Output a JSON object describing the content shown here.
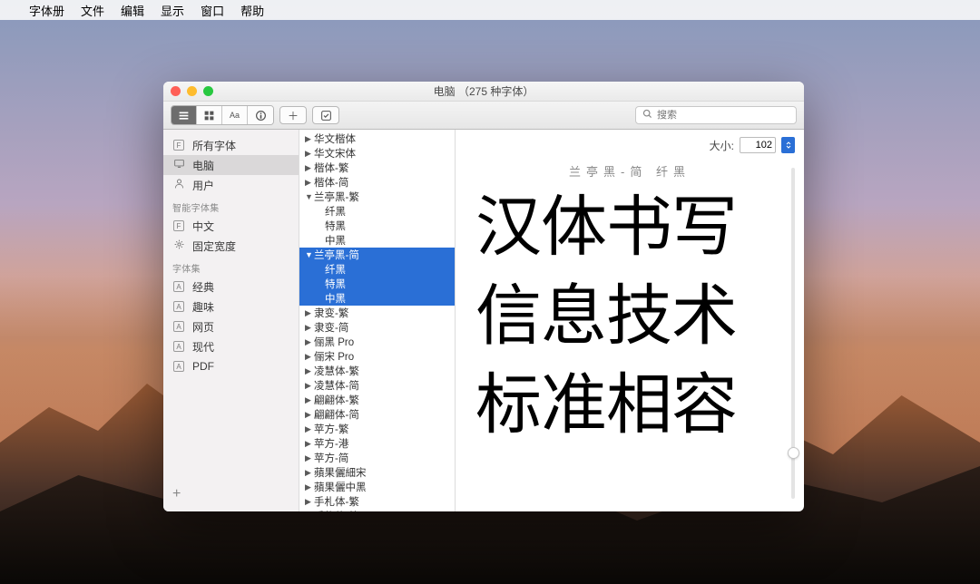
{
  "menubar": {
    "apple": "",
    "items": [
      "字体册",
      "文件",
      "编辑",
      "显示",
      "窗口",
      "帮助"
    ]
  },
  "window": {
    "title": "电脑  （275 种字体）"
  },
  "toolbar": {
    "view_list": "≡",
    "view_grid": "⊞",
    "view_sample": "Aa",
    "view_info": "ⓘ",
    "add": "＋",
    "toggle": "☑",
    "search_placeholder": "搜索"
  },
  "sidebar": {
    "collections": [
      {
        "icon": "F",
        "label": "所有字体",
        "key": "all-fonts"
      },
      {
        "icon": "monitor",
        "label": "电脑",
        "key": "computer",
        "selected": true
      },
      {
        "icon": "user",
        "label": "用户",
        "key": "user"
      }
    ],
    "smart_header": "智能字体集",
    "smart": [
      {
        "icon": "F",
        "label": "中文",
        "key": "chinese"
      },
      {
        "icon": "gear",
        "label": "固定宽度",
        "key": "fixed-width"
      }
    ],
    "fontset_header": "字体集",
    "fontsets": [
      {
        "icon": "A",
        "label": "经典",
        "key": "classic"
      },
      {
        "icon": "A",
        "label": "趣味",
        "key": "fun"
      },
      {
        "icon": "A",
        "label": "网页",
        "key": "web"
      },
      {
        "icon": "A",
        "label": "现代",
        "key": "modern"
      },
      {
        "icon": "A",
        "label": "PDF",
        "key": "pdf"
      }
    ],
    "add": "+"
  },
  "fontlist": [
    {
      "t": "item",
      "arrow": "▶",
      "label": "华文楷体"
    },
    {
      "t": "item",
      "arrow": "▶",
      "label": "华文宋体"
    },
    {
      "t": "item",
      "arrow": "▶",
      "label": "楷体-繁"
    },
    {
      "t": "item",
      "arrow": "▶",
      "label": "楷体-简"
    },
    {
      "t": "item",
      "arrow": "▼",
      "label": "兰亭黑-繁"
    },
    {
      "t": "child",
      "label": "纤黑"
    },
    {
      "t": "child",
      "label": "特黑"
    },
    {
      "t": "child",
      "label": "中黑"
    },
    {
      "t": "item",
      "arrow": "▼",
      "label": "兰亭黑-简",
      "selected": true
    },
    {
      "t": "child",
      "label": "纤黑",
      "selchild": true
    },
    {
      "t": "child",
      "label": "特黑",
      "selchild": true
    },
    {
      "t": "child",
      "label": "中黑",
      "selchild": true
    },
    {
      "t": "item",
      "arrow": "▶",
      "label": "隶变-繁"
    },
    {
      "t": "item",
      "arrow": "▶",
      "label": "隶变-简"
    },
    {
      "t": "item",
      "arrow": "▶",
      "label": "俪黑 Pro"
    },
    {
      "t": "item",
      "arrow": "▶",
      "label": "俪宋 Pro"
    },
    {
      "t": "item",
      "arrow": "▶",
      "label": "凌慧体-繁"
    },
    {
      "t": "item",
      "arrow": "▶",
      "label": "凌慧体-简"
    },
    {
      "t": "item",
      "arrow": "▶",
      "label": "翩翩体-繁"
    },
    {
      "t": "item",
      "arrow": "▶",
      "label": "翩翩体-简"
    },
    {
      "t": "item",
      "arrow": "▶",
      "label": "苹方-繁"
    },
    {
      "t": "item",
      "arrow": "▶",
      "label": "苹方-港"
    },
    {
      "t": "item",
      "arrow": "▶",
      "label": "苹方-简"
    },
    {
      "t": "item",
      "arrow": "▶",
      "label": "蘋果儷細宋"
    },
    {
      "t": "item",
      "arrow": "▶",
      "label": "蘋果儷中黑"
    },
    {
      "t": "item",
      "arrow": "▶",
      "label": "手札体-繁"
    },
    {
      "t": "item",
      "arrow": "▶",
      "label": "手札体-简"
    }
  ],
  "preview": {
    "size_label": "大小:",
    "size_value": "102",
    "font_name": "兰亭黑-简 纤黑",
    "sample_text": "汉体书写\n信息技术\n标准相容"
  }
}
